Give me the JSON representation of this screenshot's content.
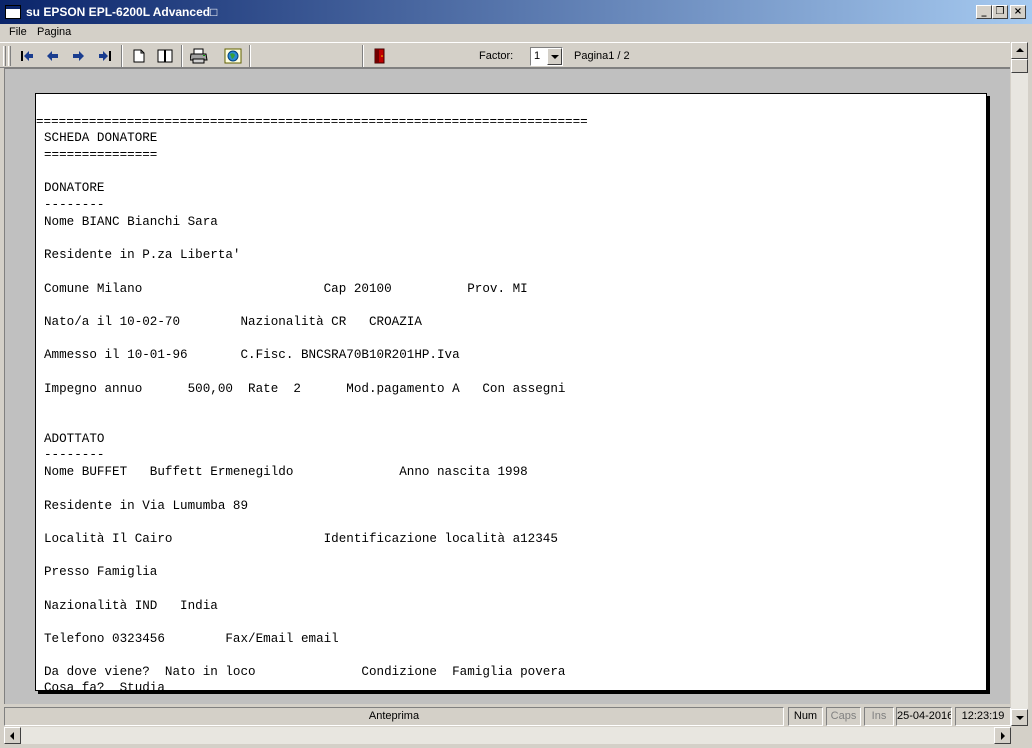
{
  "window": {
    "title": "su EPSON EPL-6200L Advanced□",
    "min_glyph": "_",
    "restore_glyph": "❒",
    "close_glyph": "×"
  },
  "menu": {
    "items": [
      "File",
      "Pagina"
    ]
  },
  "toolbar": {
    "factor_label": "Factor:",
    "factor_value": "1",
    "page_indicator": "Pagina1 / 2",
    "icons": [
      "first-page-icon",
      "prev-page-icon",
      "next-page-icon",
      "last-page-icon",
      "single-page-icon",
      "two-pages-icon",
      "printer-icon",
      "export-icon",
      "exit-door-icon"
    ]
  },
  "document": {
    "lines": [
      "=========================================================================",
      "SCHEDA DONATORE",
      "===============",
      "",
      "DONATORE",
      "--------",
      "Nome BIANC Bianchi Sara",
      "",
      "Residente in P.za Liberta'",
      "",
      "Comune Milano                        Cap 20100          Prov. MI",
      "",
      "Nato/a il 10-02-70        Nazionalità CR   CROAZIA",
      "",
      "Ammesso il 10-01-96       C.Fisc. BNCSRA70B10R201HP.Iva",
      "",
      "Impegno annuo      500,00  Rate  2      Mod.pagamento A   Con assegni",
      "",
      "",
      "ADOTTATO",
      "--------",
      "Nome BUFFET   Buffett Ermenegildo              Anno nascita 1998",
      "",
      "Residente in Via Lumumba 89",
      "",
      "Località Il Cairo                    Identificazione località a12345",
      "",
      "Presso Famiglia",
      "",
      "Nazionalità IND   India",
      "",
      "Telefono 0323456        Fax/Email email",
      "",
      "Da dove viene?  Nato in loco              Condizione  Famiglia povera",
      "Cosa fa?  Studia"
    ]
  },
  "statusbar": {
    "mode": "Anteprima",
    "num": "Num",
    "caps": "Caps",
    "ins": "Ins",
    "date": "25-04-2016",
    "time": "12:23:19"
  }
}
